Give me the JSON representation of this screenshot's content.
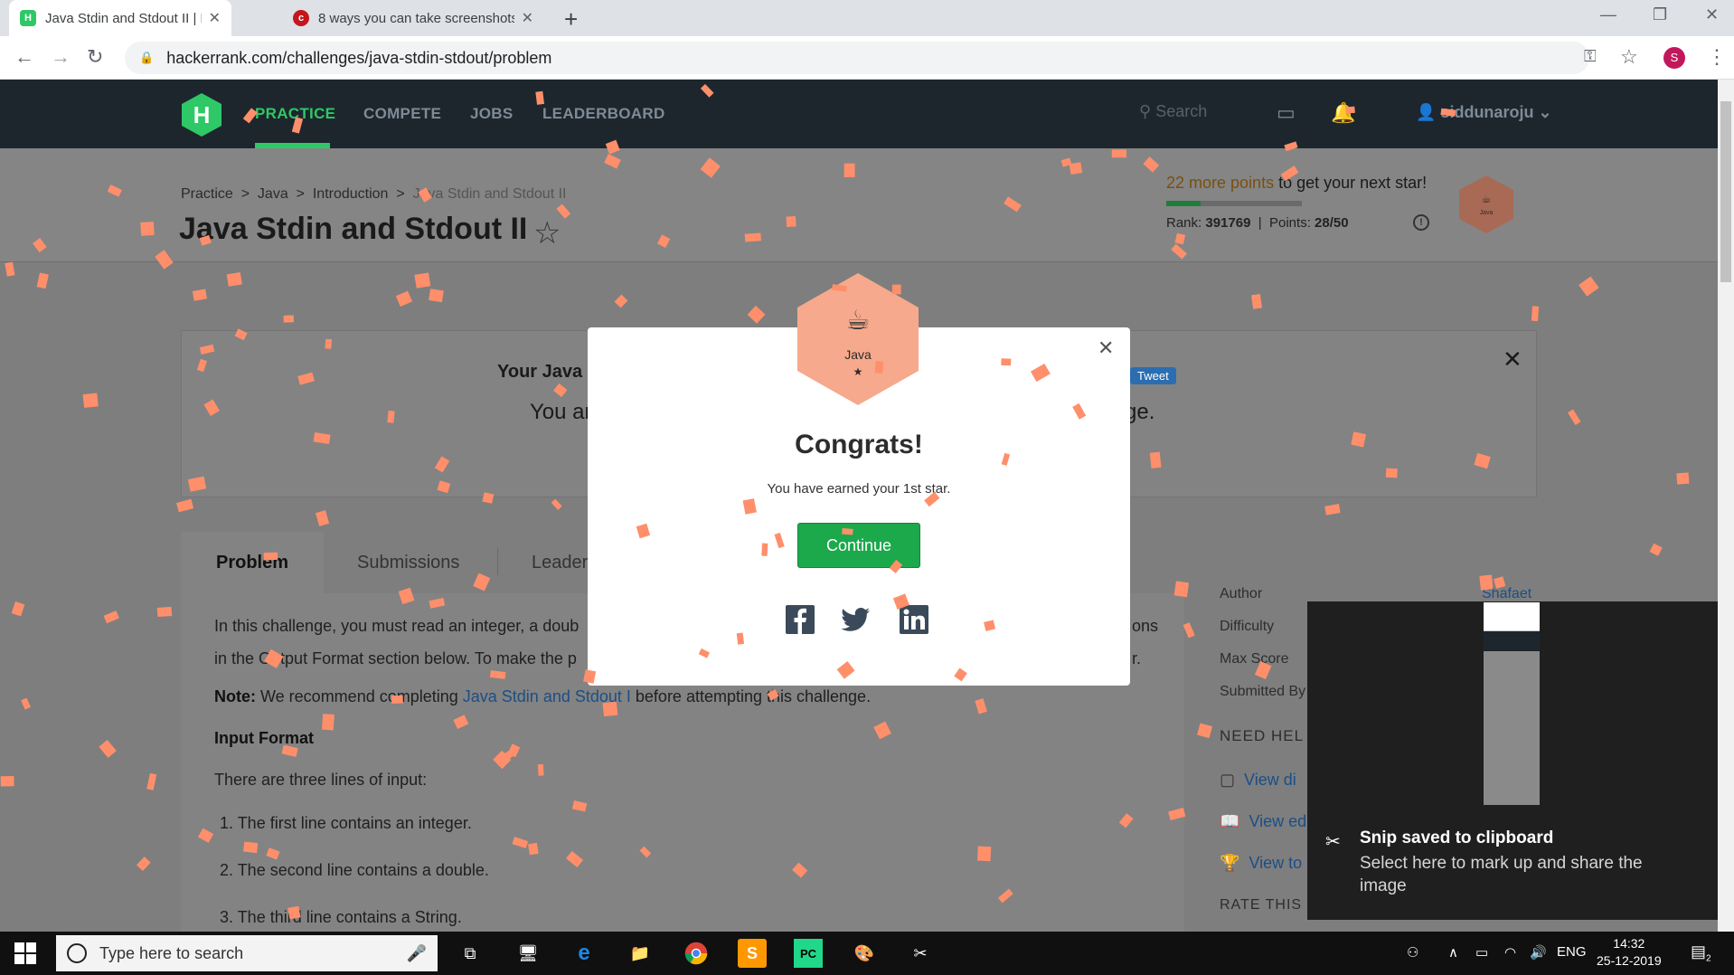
{
  "browser": {
    "tabs": [
      {
        "title": "Java Stdin and Stdout II | HackerRank",
        "favicon": "hackerrank-icon",
        "active": true
      },
      {
        "title": "8 ways you can take screenshots",
        "favicon": "cnet-icon",
        "active": false
      }
    ],
    "url": "hackerrank.com/challenges/java-stdin-stdout/problem",
    "profile_initial": "S"
  },
  "nav": {
    "items": [
      "PRACTICE",
      "COMPETE",
      "JOBS",
      "LEADERBOARD"
    ],
    "search_placeholder": "Search",
    "username": "siddunaroju"
  },
  "header": {
    "breadcrumb": [
      "Practice",
      "Java",
      "Introduction",
      "Java Stdin and Stdout II"
    ],
    "title": "Java Stdin and Stdout II",
    "points_needed": "22 more points",
    "points_suffix": " to get your next star!",
    "progress": 0.25,
    "rank_label": "Rank:",
    "rank": "391769",
    "points_label": "Points:",
    "points": "28/50",
    "badge_label": "Java"
  },
  "banner": {
    "title_fragment": "Your Java",
    "text_left": "You ar",
    "text_right": "ge.",
    "tweet": "Tweet"
  },
  "tabs": [
    "Problem",
    "Submissions",
    "Leader"
  ],
  "problem": {
    "line1_left": "In this challenge, you must read an integer, a doub",
    "line1_right": "ons",
    "line2_left": "in the Output Format section below. To make the p",
    "line2_right": "r.",
    "note_label": "Note:",
    "note_pre": " We recommend completing ",
    "note_link": "Java Stdin and Stdout I",
    "note_post": " before attempting this challenge.",
    "input_heading": "Input Format",
    "input_intro": "There are three lines of input:",
    "items": [
      "1. The first line contains an integer.",
      "2. The second line contains a double.",
      "3. The third line contains a String."
    ]
  },
  "sidebar": {
    "author_label": "Author",
    "author_value": "Shafaet",
    "difficulty_label": "Difficulty",
    "max_score_label": "Max Score",
    "submitted_label": "Submitted By",
    "need_help": "NEED HEL",
    "links": [
      "View di",
      "View ed",
      "View to"
    ],
    "rate": "RATE THIS CHALLENGE"
  },
  "modal": {
    "badge_label": "Java",
    "title": "Congrats!",
    "message": "You have earned your 1st star.",
    "continue_label": "Continue",
    "socials": [
      "facebook-icon",
      "twitter-icon",
      "linkedin-icon"
    ]
  },
  "toast": {
    "title": "Snip saved to clipboard",
    "message": "Select here to mark up and share the image"
  },
  "taskbar": {
    "search_placeholder": "Type here to search",
    "language": "ENG",
    "time": "14:32",
    "date": "25-12-2019",
    "notifications": "2"
  },
  "colors": {
    "accent": "#2ec866",
    "confetti": "#ff8f6b",
    "badge": "#f6a98c",
    "continue": "#1ba94c"
  }
}
